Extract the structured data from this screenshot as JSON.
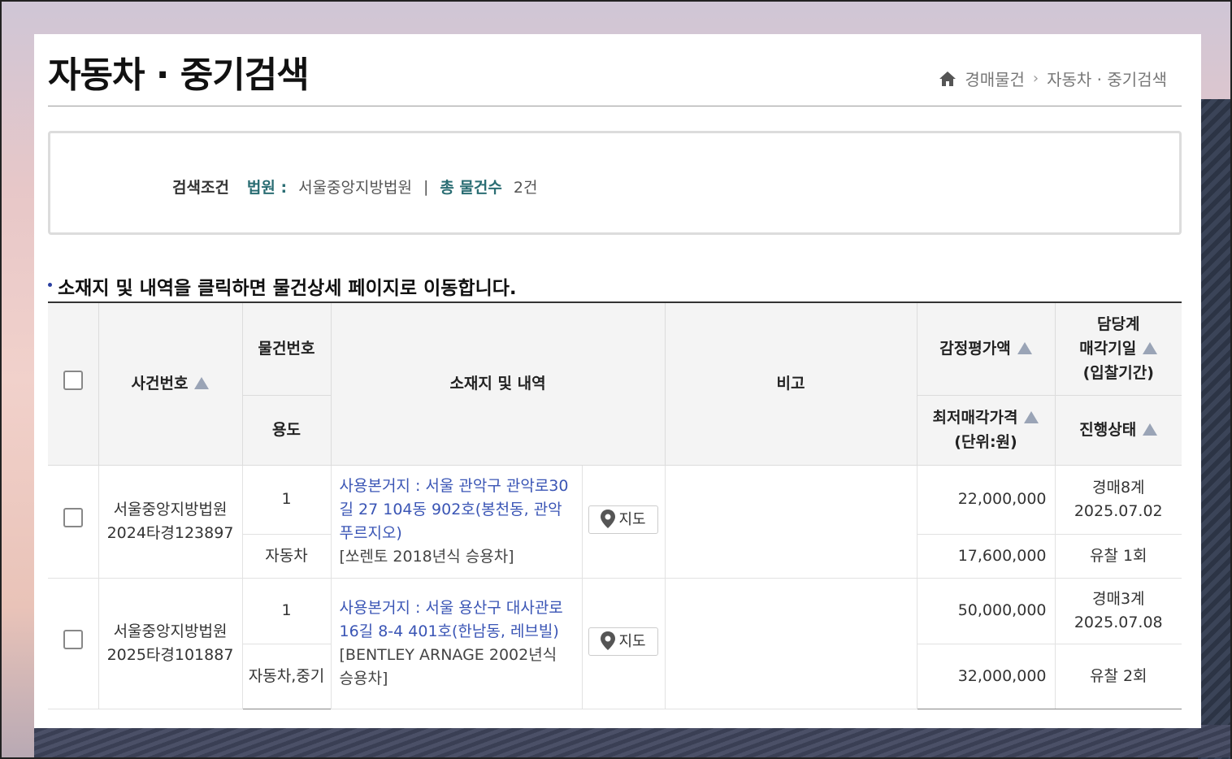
{
  "header": {
    "title": "자동차 · 중기검색",
    "breadcrumb": {
      "root": "경매물건",
      "current": "자동차 · 중기검색"
    }
  },
  "search": {
    "label": "검색조건",
    "court_key": "법원 :",
    "court_value": "서울중앙지방법원",
    "divider": "|",
    "total_key": "총 물건수",
    "total_value": "2건"
  },
  "notice": "소재지 및 내역을 클릭하면 물건상세 페이지로 이동합니다.",
  "table": {
    "headers": {
      "case_no": "사건번호",
      "item_no": "물건번호",
      "usage": "용도",
      "location": "소재지 및 내역",
      "remarks": "비고",
      "appraisal": "감정평가액",
      "min_price_1": "최저매각가격",
      "min_price_2": "(단위:원)",
      "dept": "담당계",
      "sale_date": "매각기일",
      "bid_period": "(입찰기간)",
      "status": "진행상태"
    },
    "map_label": "지도",
    "rows": [
      {
        "court": "서울중앙지방법원",
        "case": "2024타경123897",
        "item_no": "1",
        "usage": "자동차",
        "address": "사용본거지 : 서울 관악구 관악로30길 27 104동 902호(봉천동, 관악푸르지오)",
        "desc": "[쏘렌토 2018년식 승용차]",
        "appraisal": "22,000,000",
        "min_price": "17,600,000",
        "dept": "경매8계",
        "sale_date": "2025.07.02",
        "status": "유찰 1회"
      },
      {
        "court": "서울중앙지방법원",
        "case": "2025타경101887",
        "item_no": "1",
        "usage": "자동차,중기",
        "address": "사용본거지 : 서울 용산구 대사관로16길 8-4 401호(한남동, 레브빌)",
        "desc": "[BENTLEY ARNAGE 2002년식 승용차]",
        "appraisal": "50,000,000",
        "min_price": "32,000,000",
        "dept": "경매3계",
        "sale_date": "2025.07.08",
        "status": "유찰 2회"
      }
    ]
  }
}
